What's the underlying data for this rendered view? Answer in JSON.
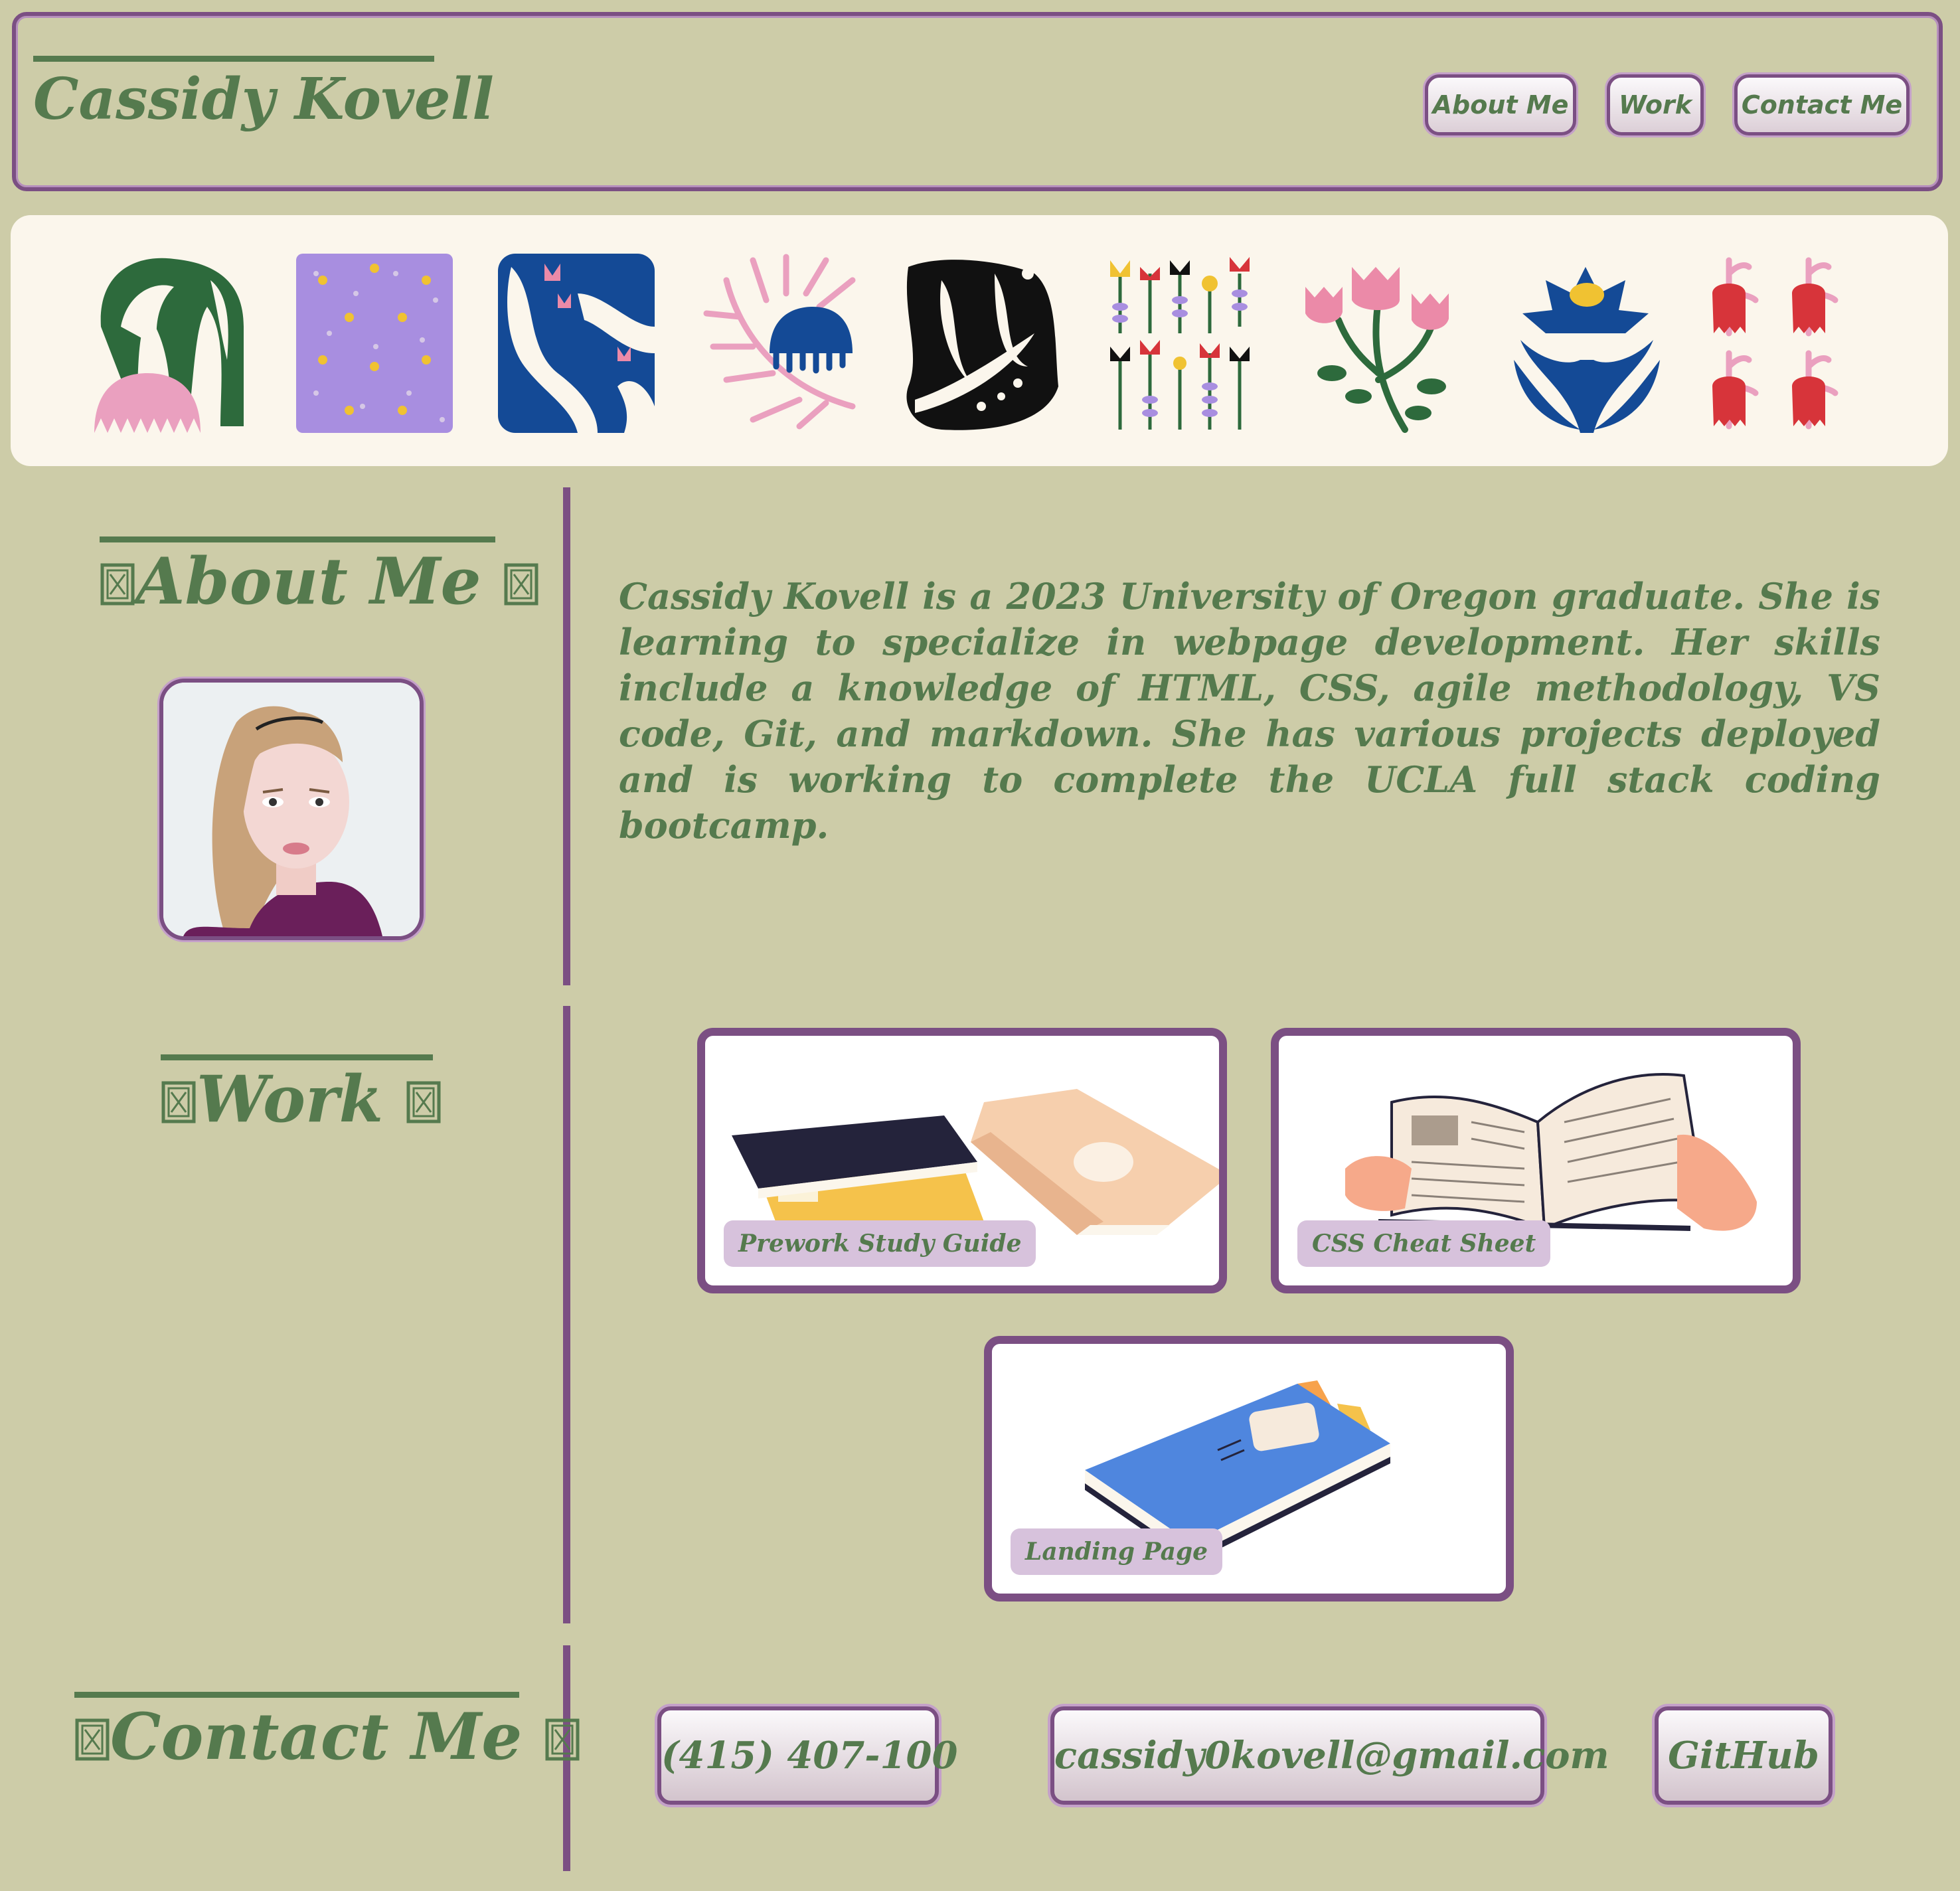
{
  "header": {
    "title": "Cassidy Kovell",
    "nav": [
      "About Me",
      "Work",
      "Contact Me"
    ]
  },
  "banner": {
    "tiles": [
      "tulip-leaf-tile",
      "purple-flowers-tile",
      "blue-tulips-tile",
      "pink-fern-tile",
      "black-seaweed-tile",
      "wildflowers-tile",
      "pink-tulip-stem-tile",
      "blue-flower-tile",
      "red-bells-tile"
    ]
  },
  "about": {
    "heading": "About Me",
    "bio": "Cassidy Kovell is a 2023 University of Oregon graduate. She is learning to specialize in webpage development. Her skills include a knowledge of HTML, CSS, agile methodology, VS code, Git, and markdown. She has various projects deployed and is working to complete the UCLA full stack coding bootcamp."
  },
  "work": {
    "heading": "Work",
    "projects": [
      {
        "label": "Prework Study Guide"
      },
      {
        "label": "CSS Cheat Sheet"
      },
      {
        "label": "Landing Page"
      }
    ]
  },
  "contact": {
    "heading": "Contact Me",
    "phone": "(415) 407-100",
    "email": "cassidy0kovell@gmail.com",
    "github": "GitHub"
  },
  "colors": {
    "background": "#cdcca8",
    "accent": "#7b4f83",
    "text": "#557a4e",
    "banner": "#fbf6ec",
    "label_bg": "#d7c2dc"
  }
}
